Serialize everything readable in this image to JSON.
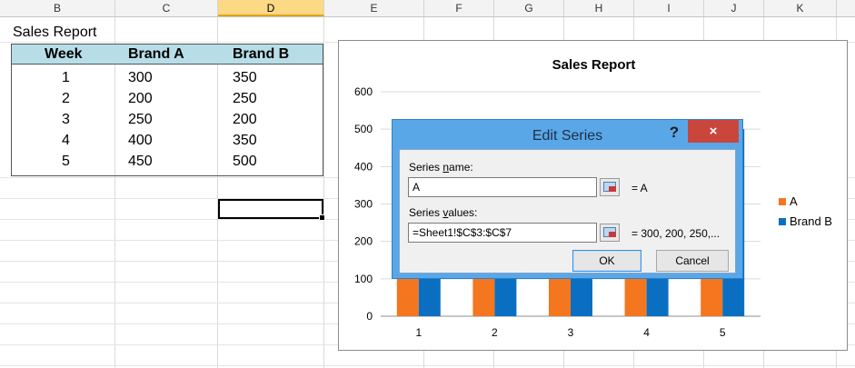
{
  "sheet": {
    "columns": [
      "B",
      "C",
      "D",
      "E",
      "F",
      "G",
      "H",
      "I",
      "J",
      "K"
    ],
    "selected_column": "D",
    "title": "Sales Report",
    "table": {
      "headers": [
        "Week",
        "Brand A",
        "Brand B"
      ],
      "rows": [
        [
          "1",
          "300",
          "350"
        ],
        [
          "2",
          "200",
          "250"
        ],
        [
          "3",
          "250",
          "200"
        ],
        [
          "4",
          "400",
          "350"
        ],
        [
          "5",
          "450",
          "500"
        ]
      ]
    }
  },
  "chart_data": {
    "type": "bar",
    "title": "Sales Report",
    "categories": [
      "1",
      "2",
      "3",
      "4",
      "5"
    ],
    "series": [
      {
        "name": "A",
        "values": [
          300,
          200,
          250,
          400,
          450
        ],
        "color": "#f4761f"
      },
      {
        "name": "Brand B",
        "values": [
          350,
          250,
          200,
          350,
          500
        ],
        "color": "#0b6fc1"
      }
    ],
    "ylim": [
      0,
      600
    ],
    "yticks": [
      0,
      100,
      200,
      300,
      400,
      500,
      600
    ],
    "grid": true,
    "legend": "right"
  },
  "dialog": {
    "title": "Edit Series",
    "help": "?",
    "close": "×",
    "series_name_label_pre": "Series ",
    "series_name_label_u": "n",
    "series_name_label_post": "ame:",
    "series_name_value": "A",
    "series_name_result": "= A",
    "series_values_label_pre": "Series ",
    "series_values_label_u": "v",
    "series_values_label_post": "alues:",
    "series_values_value": "=Sheet1!$C$3:$C$7",
    "series_values_result": "= 300, 200, 250,...",
    "ok": "OK",
    "cancel": "Cancel"
  }
}
